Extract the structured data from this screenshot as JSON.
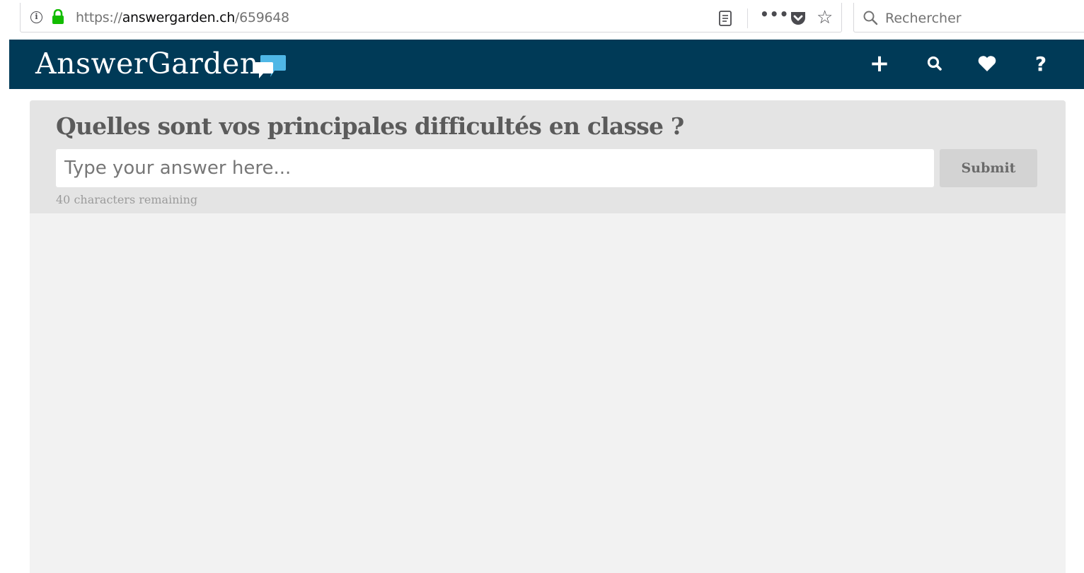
{
  "browser": {
    "url_protocol": "https://",
    "url_domain": "answergarden.ch",
    "url_path": "/659648",
    "search_placeholder": "Rechercher",
    "icons": [
      "info-icon",
      "lock-icon",
      "reader-view-icon",
      "page-actions-icon",
      "pocket-icon",
      "bookmark-star-icon",
      "search-icon"
    ]
  },
  "header": {
    "logo_text": "AnswerGarden",
    "nav": {
      "add_label": "+",
      "help_label": "?"
    },
    "colors": {
      "background": "#003a57",
      "logo_accent": "#4fb7e6"
    }
  },
  "question_panel": {
    "question": "Quelles sont vos principales difficultés en classe ?",
    "input_placeholder": "Type your answer here...",
    "submit_label": "Submit",
    "chars_remaining": "40 characters remaining"
  }
}
